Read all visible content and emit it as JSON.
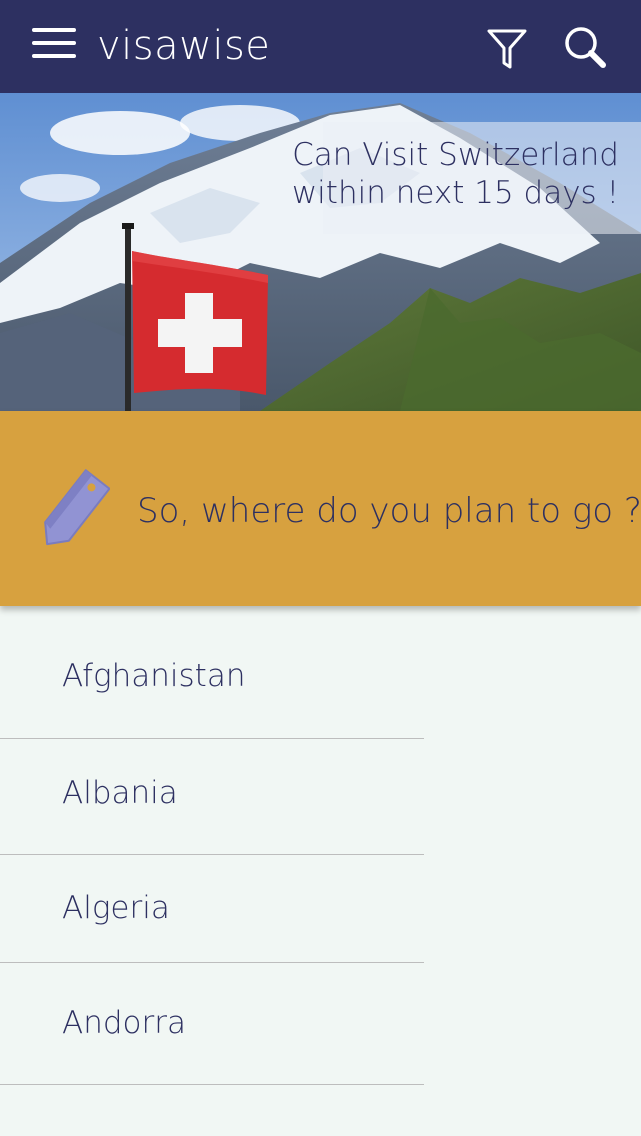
{
  "app_bar": {
    "title": "visawise",
    "menu_icon": "hamburger-icon",
    "filter_icon": "filter-icon",
    "search_icon": "search-icon",
    "background": "#2d3061"
  },
  "hero": {
    "caption_line1": "Can Visit Switzerland",
    "caption_line2": "within next 15 days !"
  },
  "prompt": {
    "icon": "tag-icon",
    "text": "So, where do you plan to go ?",
    "background": "#d7a13f"
  },
  "countries": [
    {
      "name": "Afghanistan"
    },
    {
      "name": "Albania"
    },
    {
      "name": "Algeria"
    },
    {
      "name": "Andorra"
    }
  ]
}
